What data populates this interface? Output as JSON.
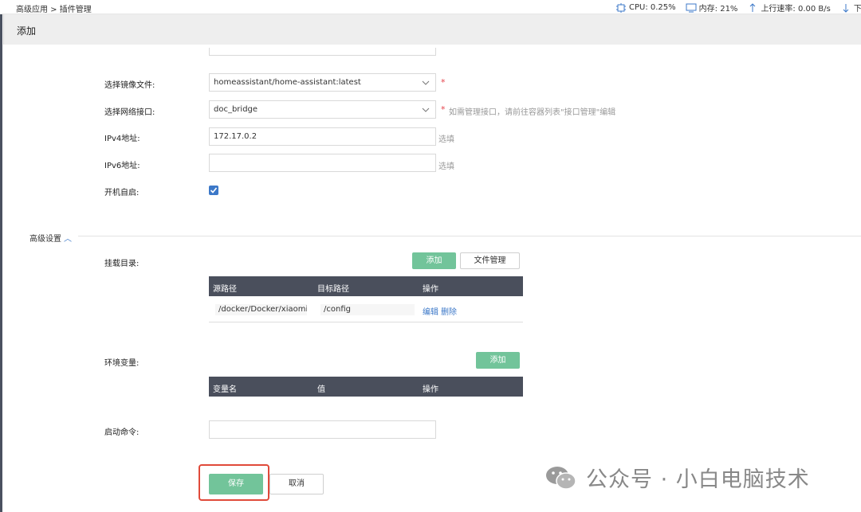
{
  "breadcrumb": "高级应用 > 插件管理",
  "stats": {
    "cpu": "CPU: 0.25%",
    "memory": "内存: 21%",
    "upload": "上行速率: 0.00 B/s",
    "download": "下行"
  },
  "page_title": "添加",
  "form": {
    "image": {
      "label": "选择镜像文件:",
      "value": "homeassistant/home-assistant:latest",
      "required": "*"
    },
    "network": {
      "label": "选择网络接口:",
      "value": "doc_bridge",
      "required": "*",
      "hint": "如需管理接口，请前往容器列表\"接口管理\"编辑"
    },
    "ipv4": {
      "label": "IPv4地址:",
      "value": "172.17.0.2",
      "hint": "选填"
    },
    "ipv6": {
      "label": "IPv6地址:",
      "value": "",
      "hint": "选填"
    },
    "autostart": {
      "label": "开机自启:",
      "checked": true
    }
  },
  "advanced": {
    "title": "高级设置",
    "mount": {
      "label": "挂载目录:",
      "add_button": "添加",
      "file_manager_button": "文件管理",
      "columns": [
        "源路径",
        "目标路径",
        "操作"
      ],
      "rows": [
        {
          "source": "/docker/Docker/xiaomi/c",
          "target": "/config",
          "edit": "编辑",
          "delete": "删除"
        }
      ]
    },
    "env": {
      "label": "环境变量:",
      "add_button": "添加",
      "columns": [
        "变量名",
        "值",
        "操作"
      ]
    },
    "command": {
      "label": "启动命令:",
      "value": ""
    }
  },
  "actions": {
    "save": "保存",
    "cancel": "取消"
  },
  "watermark": "公众号 · 小白电脑技术",
  "colors": {
    "accent_green": "#72c49a",
    "link_blue": "#3c78c8",
    "header_dark": "#4a4f5c",
    "required_red": "#e5434b",
    "highlight_red": "#e04a3a"
  }
}
